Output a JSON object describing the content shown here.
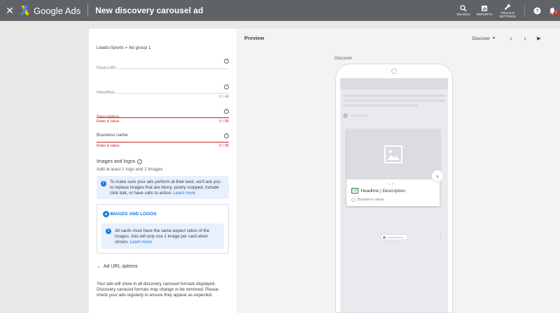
{
  "app": {
    "product": "Google Ads",
    "page_title": "New discovery carousel ad"
  },
  "top_actions": [
    {
      "label": "SEARCH",
      "icon": "search-icon"
    },
    {
      "label": "REPORTS",
      "icon": "reports-icon"
    },
    {
      "label": "TOOLS & SETTINGS",
      "icon": "wrench-icon"
    }
  ],
  "notifications": {
    "count": "1"
  },
  "form": {
    "breadcrumb": "Leads-Sports > Ad group 1",
    "final_url": {
      "label": "Final URL"
    },
    "headline": {
      "label": "Headline",
      "counter": "0 / 40"
    },
    "description": {
      "label": "Description",
      "error": "Enter a value",
      "counter": "0 / 90"
    },
    "business_name": {
      "label": "Business name",
      "error": "Enter a value",
      "counter": "0 / 25"
    },
    "images": {
      "title": "Images and logos",
      "subtitle": "Add at least 1 logo and 2 images",
      "info": "To make sure your ads perform at their best, we'll ask you to replace images that are blurry, poorly cropped, include click bait, or have calls to action.",
      "info_link": "Learn more",
      "add_button": "IMAGES AND LOGOS",
      "card_info": "All cards must have the same aspect ratios of the images. Ads will only use 1 image per card when shown.",
      "card_info_link": "Learn more"
    },
    "url_options": "Ad URL options",
    "footer": "Your ads will show in all discovery carousel formats displayed. Discovery carousel formats may change or be removed. Please check your ads regularly to ensure they appear as expected."
  },
  "preview": {
    "title": "Preview",
    "placement": "Discover",
    "device_label": "Discover",
    "card": {
      "headline": "Headline | Description",
      "ad_badge": "Ad",
      "business": "Business name",
      "pager": "• •"
    }
  },
  "colors": {
    "topbar": "#5f6368",
    "link": "#1a73e8",
    "error": "#c5221f"
  }
}
